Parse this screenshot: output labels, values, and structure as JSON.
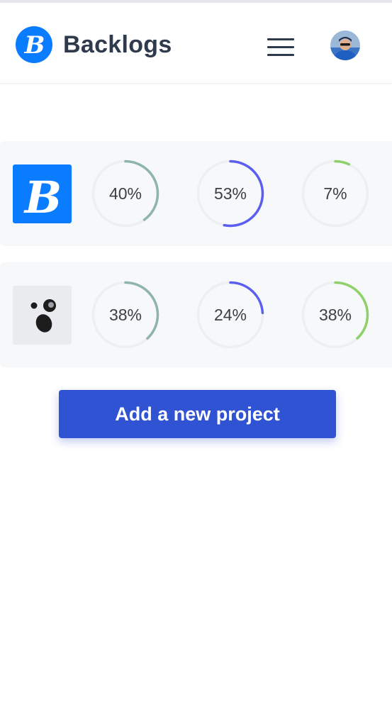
{
  "header": {
    "brand_name": "Backlogs",
    "menu_icon": "hamburger-menu-icon",
    "avatar_icon": "user-avatar"
  },
  "projects": [
    {
      "icon": "backlogs-b-logo",
      "icon_bg": "#0a7cff",
      "progress": [
        {
          "label": "40%",
          "value": 0.4,
          "color": "#8fb3ad"
        },
        {
          "label": "53%",
          "value": 0.53,
          "color": "#5a5ff0"
        },
        {
          "label": "7%",
          "value": 0.07,
          "color": "#8ed16a"
        }
      ]
    },
    {
      "icon": "ghost-face-logo",
      "icon_bg": "#e9ebee",
      "progress": [
        {
          "label": "38%",
          "value": 0.38,
          "color": "#8fb3ad"
        },
        {
          "label": "24%",
          "value": 0.24,
          "color": "#5a5ff0"
        },
        {
          "label": "38%",
          "value": 0.38,
          "color": "#8ed16a"
        }
      ]
    }
  ],
  "add_project_label": "Add a new project",
  "colors": {
    "brand_text": "#2f3a4c",
    "button": "#3053d4",
    "row_bg": "#f7f8fa",
    "track": "#eeeff1"
  }
}
